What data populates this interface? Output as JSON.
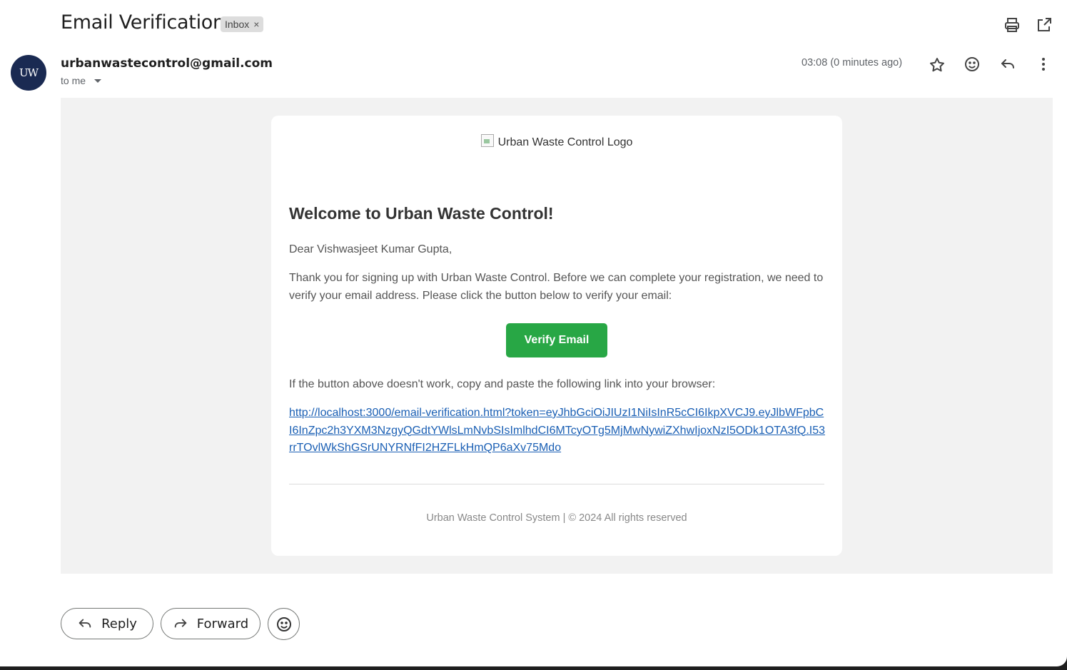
{
  "email": {
    "subject": "Email Verification",
    "label": "Inbox",
    "label_remove": "×",
    "sender": "urbanwastecontrol@gmail.com",
    "avatar_text": "UW",
    "recipient": "to me",
    "timestamp": "03:08 (0 minutes ago)"
  },
  "body": {
    "logo_alt": "Urban Waste Control Logo",
    "heading": "Welcome to Urban Waste Control!",
    "greeting": "Dear Vishwasjeet Kumar Gupta,",
    "intro": "Thank you for signing up with Urban Waste Control. Before we can complete your registration, we need to verify your email address. Please click the button below to verify your email:",
    "button_label": "Verify Email",
    "fallback_text": "If the button above doesn't work, copy and paste the following link into your browser:",
    "verification_link": "http://localhost:3000/email-verification.html?token=eyJhbGciOiJIUzI1NiIsInR5cCI6IkpXVCJ9.eyJlbWFpbCI6InZpc2h3YXM3NzgyQGdtYWlsLmNvbSIsImlhdCI6MTcyOTg5MjMwNywiZXhwIjoxNzI5ODk1OTA3fQ.I53rrTOvlWkShGSrUNYRNfFI2HZFLkHmQP6aXv75Mdo",
    "footer": "Urban Waste Control System | © 2024 All rights reserved"
  },
  "actions": {
    "reply_label": "Reply",
    "forward_label": "Forward"
  },
  "icons": [
    "print-icon",
    "open-in-new-window-icon",
    "star-icon",
    "emoji-icon",
    "reply-icon",
    "more-vert-icon",
    "forward-icon"
  ],
  "colors": {
    "verify_button": "#28a745",
    "link": "#1a5fb4",
    "avatar_bg": "#1a2a52"
  }
}
